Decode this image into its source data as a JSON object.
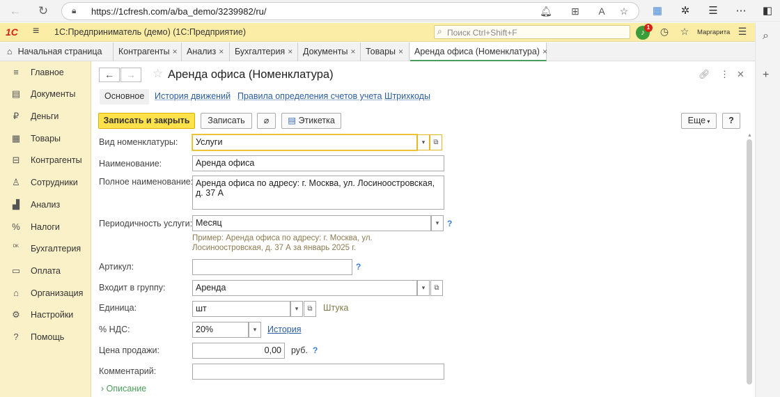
{
  "browser": {
    "url_prefix": "https://",
    "url_host": "1cfresh.com",
    "url_path": "/a/ba_demo/3239982/ru/",
    "back_icon": "back-arrow-icon",
    "refresh_icon": "refresh-icon"
  },
  "app": {
    "logo": "1С",
    "title": "1С:Предприниматель (демо)  (1С:Предприятие)",
    "search_placeholder": "Поиск Ctrl+Shift+F",
    "notification_count": "1",
    "user": "Маргарита"
  },
  "tabs": {
    "home": "Начальная страница",
    "items": [
      "Контрагенты",
      "Анализ",
      "Бухгалтерия",
      "Документы",
      "Товары",
      "Аренда офиса (Номенклатура)"
    ],
    "close": "×"
  },
  "sidebar": {
    "items": [
      {
        "label": "Главное",
        "icon": "≡"
      },
      {
        "label": "Документы",
        "icon": "▤"
      },
      {
        "label": "Деньги",
        "icon": "₽"
      },
      {
        "label": "Товары",
        "icon": "▦"
      },
      {
        "label": "Контрагенты",
        "icon": "⊟"
      },
      {
        "label": "Сотрудники",
        "icon": "♙"
      },
      {
        "label": "Анализ",
        "icon": "▟"
      },
      {
        "label": "Налоги",
        "icon": "%"
      },
      {
        "label": "Бухгалтерия",
        "icon": "ᴰᴷ"
      },
      {
        "label": "Оплата",
        "icon": "▭"
      },
      {
        "label": "Организация",
        "icon": "⌂"
      },
      {
        "label": "Настройки",
        "icon": "⚙"
      },
      {
        "label": "Помощь",
        "icon": "?"
      }
    ]
  },
  "form": {
    "title": "Аренда офиса (Номенклатура)",
    "subtabs": {
      "main": "Основное",
      "history": "История движений",
      "rules": "Правила определения счетов учета",
      "barcodes": "Штрихкоды"
    },
    "toolbar": {
      "save_close": "Записать и закрыть",
      "save": "Записать",
      "label": "Этикетка",
      "more": "Еще",
      "help": "?"
    },
    "fields": {
      "kind_label": "Вид номенклатуры:",
      "kind_value": "Услуги",
      "name_label": "Наименование:",
      "name_value": "Аренда офиса",
      "fullname_label": "Полное наименование:",
      "fullname_value": "Аренда офиса по адресу: г. Москва, ул. Лосиноостровская, д. 37 А",
      "period_label": "Периодичность услуги:",
      "period_value": "Месяц",
      "period_hint": "Пример: Аренда офиса по адресу: г. Москва, ул. Лосиноостровская, д. 37 А за январь 2025 г.",
      "article_label": "Артикул:",
      "article_value": "",
      "group_label": "Входит в группу:",
      "group_value": "Аренда",
      "unit_label": "Единица:",
      "unit_value": "шт",
      "unit_name": "Штука",
      "vat_label": "% НДС:",
      "vat_value": "20%",
      "vat_history": "История",
      "price_label": "Цена продажи:",
      "price_value": "0,00",
      "price_currency": "руб.",
      "comment_label": "Комментарий:",
      "comment_value": "",
      "help_mark": "?"
    },
    "description_toggle": "Описание"
  }
}
